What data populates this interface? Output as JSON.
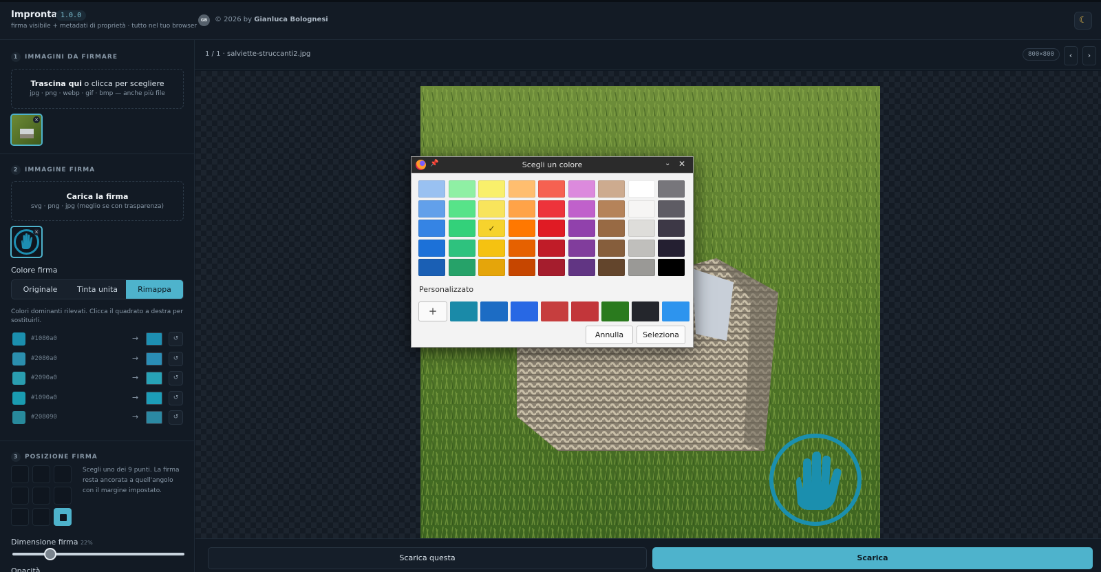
{
  "header": {
    "app_title": "Impronta",
    "version": "1.0.0",
    "subtitle": "firma visibile + metadati di proprietà · tutto nel tuo browser",
    "author_initials": "GB",
    "copyright_prefix": "© 2026 by",
    "author_name": "Gianluca Bolognesi",
    "theme_icon": "moon-icon"
  },
  "section1": {
    "number": "1",
    "title": "IMMAGINI DA FIRMARE",
    "drop_bold": "Trascina qui",
    "drop_rest": "o clicca per scegliere",
    "drop_formats": "jpg · png · webp · gif · bmp — anche più file"
  },
  "section2": {
    "number": "2",
    "title": "IMMAGINE FIRMA",
    "drop_bold": "Carica la firma",
    "drop_formats": "svg · png · jpg (meglio se con trasparenza)",
    "color_label": "Colore firma",
    "modes": [
      "Originale",
      "Tinta unita",
      "Rimappa"
    ],
    "active_mode": "Rimappa",
    "hint": "Colori dominanti rilevati. Clicca il quadrato a destra per sostituirli.",
    "colors": [
      {
        "hex": "#1080a0",
        "swatch": "#1b8fae",
        "replacement": "#1d8fb2"
      },
      {
        "hex": "#2080a0",
        "swatch": "#2b8fae",
        "replacement": "#2a8db5"
      },
      {
        "hex": "#2090a0",
        "swatch": "#2a9eb0",
        "replacement": "#27a2b6"
      },
      {
        "hex": "#1090a0",
        "swatch": "#1a9cb1",
        "replacement": "#1c9db8"
      },
      {
        "hex": "#208090",
        "swatch": "#288a9c",
        "replacement": "#2b89a3"
      }
    ],
    "arrow": "→",
    "reset_glyph": "↺"
  },
  "section3": {
    "number": "3",
    "title": "POSIZIONE FIRMA",
    "hint": "Scegli uno dei 9 punti. La firma resta ancorata a quell'angolo con il margine impostato.",
    "selected_position": "bottom-right",
    "size_label": "Dimensione firma",
    "size_value": "22%",
    "size_fraction": 0.22,
    "opacity_label": "Opacità"
  },
  "main": {
    "file_label": "1 / 1 · salviette-struccanti2.jpg",
    "dims": "800×800",
    "prev_glyph": "‹",
    "next_glyph": "›",
    "download_one": "Scarica questa",
    "download_all": "Scarica"
  },
  "color_dialog": {
    "title": "Scegli un colore",
    "custom_label": "Personalizzato",
    "add_glyph": "+",
    "cancel": "Annulla",
    "select": "Seleziona",
    "palette": [
      [
        "#99c1f1",
        "#8ff0a4",
        "#f9f06b",
        "#ffbe6f",
        "#f66151",
        "#dc8add",
        "#cdab8f",
        "#ffffff",
        "#77767b"
      ],
      [
        "#62a0ea",
        "#57e389",
        "#f8e45c",
        "#ffa348",
        "#ed333b",
        "#c061cb",
        "#b5835a",
        "#f6f5f4",
        "#5e5c64"
      ],
      [
        "#3584e4",
        "#33d17a",
        "#f6d32d",
        "#ff7800",
        "#e01b24",
        "#9141ac",
        "#986a44",
        "#deddda",
        "#3d3846"
      ],
      [
        "#1c71d8",
        "#2ec27e",
        "#f5c211",
        "#e66100",
        "#c01c28",
        "#813d9c",
        "#865e3c",
        "#c0bfbc",
        "#241f31"
      ],
      [
        "#1a5fb4",
        "#26a269",
        "#e5a50a",
        "#c64600",
        "#a51d2d",
        "#613583",
        "#63452c",
        "#9a9996",
        "#000000"
      ]
    ],
    "selected": "#f6d32d",
    "custom_colors": [
      "#1a8aa8",
      "#1c6cc4",
      "#2868e4",
      "#c63e3e",
      "#c2363a",
      "#2a7a1e",
      "#24262c",
      "#2d94ee"
    ]
  }
}
